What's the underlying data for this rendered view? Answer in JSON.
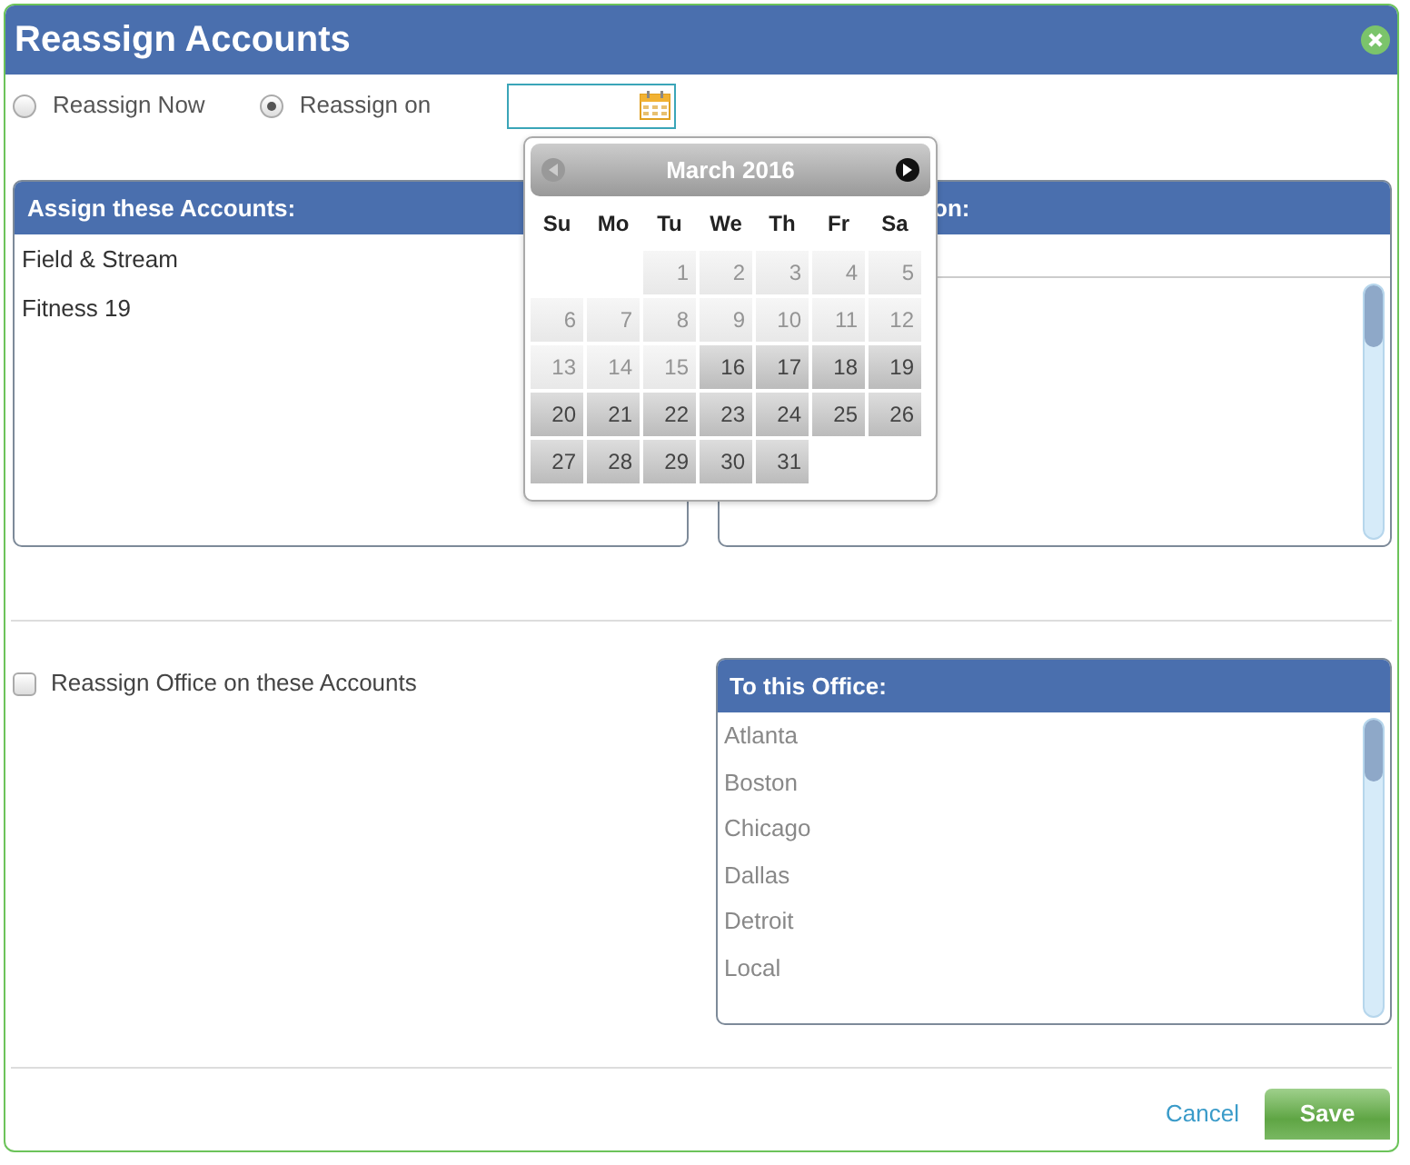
{
  "window": {
    "title": "Reassign Accounts"
  },
  "schedule": {
    "options": [
      {
        "label": "Reassign Now",
        "selected": false
      },
      {
        "label": "Reassign on",
        "selected": true
      }
    ]
  },
  "datepicker": {
    "month": "March 2016",
    "prev_disabled": true,
    "next_disabled": false,
    "weekdays": [
      "Su",
      "Mo",
      "Tu",
      "We",
      "Th",
      "Fr",
      "Sa"
    ],
    "weeks": [
      [
        {
          "kind": "blank"
        },
        {
          "kind": "blank"
        },
        {
          "kind": "day",
          "label": "1",
          "disabled": true
        },
        {
          "kind": "day",
          "label": "2",
          "disabled": true
        },
        {
          "kind": "day",
          "label": "3",
          "disabled": true
        },
        {
          "kind": "day",
          "label": "4",
          "disabled": true
        },
        {
          "kind": "day",
          "label": "5",
          "disabled": true
        }
      ],
      [
        {
          "kind": "day",
          "label": "6",
          "disabled": true
        },
        {
          "kind": "day",
          "label": "7",
          "disabled": true
        },
        {
          "kind": "day",
          "label": "8",
          "disabled": true
        },
        {
          "kind": "day",
          "label": "9",
          "disabled": true
        },
        {
          "kind": "day",
          "label": "10",
          "disabled": true
        },
        {
          "kind": "day",
          "label": "11",
          "disabled": true
        },
        {
          "kind": "day",
          "label": "12",
          "disabled": true
        }
      ],
      [
        {
          "kind": "day",
          "label": "13",
          "disabled": true
        },
        {
          "kind": "day",
          "label": "14",
          "disabled": true
        },
        {
          "kind": "day",
          "label": "15",
          "disabled": true
        },
        {
          "kind": "day",
          "label": "16",
          "disabled": false
        },
        {
          "kind": "day",
          "label": "17",
          "disabled": false
        },
        {
          "kind": "day",
          "label": "18",
          "disabled": false
        },
        {
          "kind": "day",
          "label": "19",
          "disabled": false
        }
      ],
      [
        {
          "kind": "day",
          "label": "20",
          "disabled": false
        },
        {
          "kind": "day",
          "label": "21",
          "disabled": false
        },
        {
          "kind": "day",
          "label": "22",
          "disabled": false
        },
        {
          "kind": "day",
          "label": "23",
          "disabled": false
        },
        {
          "kind": "day",
          "label": "24",
          "disabled": false
        },
        {
          "kind": "day",
          "label": "25",
          "disabled": false
        },
        {
          "kind": "day",
          "label": "26",
          "disabled": false
        }
      ],
      [
        {
          "kind": "day",
          "label": "27",
          "disabled": false
        },
        {
          "kind": "day",
          "label": "28",
          "disabled": false
        },
        {
          "kind": "day",
          "label": "29",
          "disabled": false
        },
        {
          "kind": "day",
          "label": "30",
          "disabled": false
        },
        {
          "kind": "day",
          "label": "31",
          "disabled": false
        }
      ]
    ]
  },
  "accounts_panel": {
    "title": "Assign these Accounts:",
    "items": [
      "Field & Stream",
      "Fitness 19"
    ]
  },
  "target_panel": {
    "title_visible": "on:"
  },
  "office_option": {
    "label": "Reassign Office on these Accounts",
    "checked": false
  },
  "office_panel": {
    "title": "To this Office:",
    "items": [
      "Atlanta",
      "Boston",
      "Chicago",
      "Dallas",
      "Detroit",
      "Local"
    ]
  },
  "buttons": {
    "cancel": "Cancel",
    "save": "Save"
  }
}
